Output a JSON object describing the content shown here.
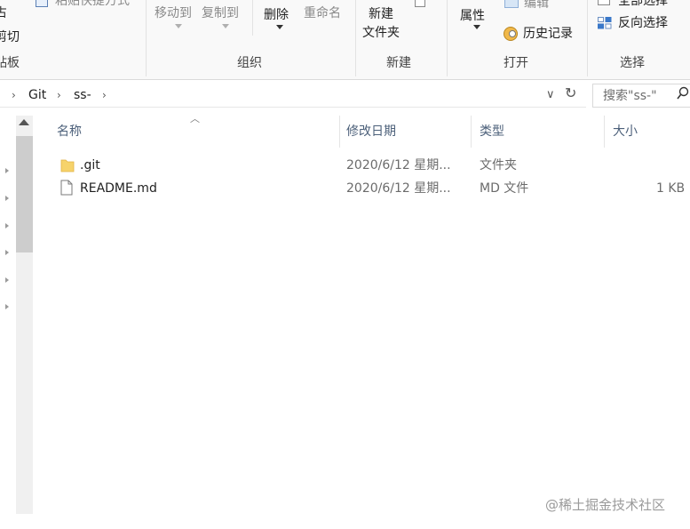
{
  "ribbon": {
    "clipboard": {
      "partial_top": "占",
      "cut": "剪切",
      "group": "贴板"
    },
    "paste_shortcut": "粘贴快捷方式",
    "organize": {
      "move_to": "移动到",
      "copy_to": "复制到",
      "delete": "删除",
      "rename": "重命名",
      "group": "组织"
    },
    "new": {
      "new_folder_line1": "新建",
      "new_folder_line2": "文件夹",
      "group": "新建"
    },
    "open": {
      "properties": "属性",
      "edit": "编辑",
      "history": "历史记录",
      "group": "打开"
    },
    "select": {
      "select_all": "全部选择",
      "invert": "反向选择",
      "group": "选择"
    }
  },
  "address": {
    "crumbs": [
      "Git",
      "ss-"
    ],
    "chevron": "›",
    "dropdown": "∨",
    "refresh": "↻"
  },
  "search": {
    "placeholder": "搜索\"ss-\""
  },
  "columns": {
    "name": "名称",
    "modified": "修改日期",
    "type": "类型",
    "size": "大小"
  },
  "files": [
    {
      "name": ".git",
      "modified": "2020/6/12 星期...",
      "type": "文件夹",
      "size": "",
      "icon": "folder-icon"
    },
    {
      "name": "README.md",
      "modified": "2020/6/12 星期...",
      "type": "MD 文件",
      "size": "1 KB",
      "icon": "file-icon"
    }
  ],
  "watermark": "@稀土掘金技术社区",
  "colors": {
    "folder": "#f6d36b",
    "header_text": "#4c607a",
    "ribbon_bg": "#f9f9f9"
  }
}
